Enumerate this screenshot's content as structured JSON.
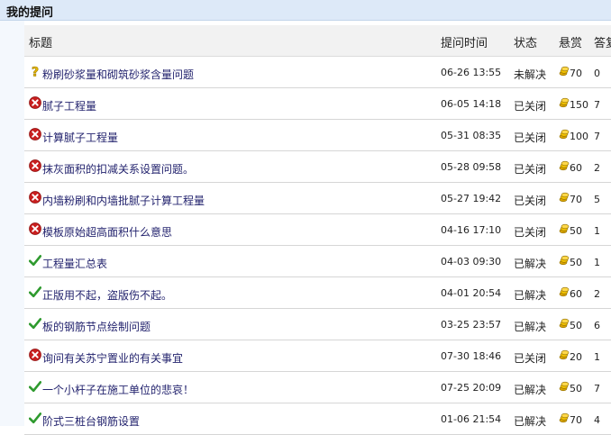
{
  "section": {
    "title": "我的提问"
  },
  "columns": {
    "title": "标题",
    "time": "提问时间",
    "status": "状态",
    "reward": "悬赏",
    "answers": "答复"
  },
  "rows": [
    {
      "icon": "question-icon",
      "title": "粉刷砂浆量和砌筑砂浆含量问题",
      "time": "06-26 13:55",
      "status": "未解决",
      "reward": "70",
      "answers": "0"
    },
    {
      "icon": "closed-icon",
      "title": "腻子工程量",
      "time": "06-05 14:18",
      "status": "已关闭",
      "reward": "150",
      "answers": "7"
    },
    {
      "icon": "closed-icon",
      "title": "计算腻子工程量",
      "time": "05-31 08:35",
      "status": "已关闭",
      "reward": "100",
      "answers": "7"
    },
    {
      "icon": "closed-icon",
      "title": "抹灰面积的扣减关系设置问题。",
      "time": "05-28 09:58",
      "status": "已关闭",
      "reward": "60",
      "answers": "2"
    },
    {
      "icon": "closed-icon",
      "title": "内墙粉刷和内墙批腻子计算工程量",
      "time": "05-27 19:42",
      "status": "已关闭",
      "reward": "70",
      "answers": "5"
    },
    {
      "icon": "closed-icon",
      "title": "模板原始超高面积什么意思",
      "time": "04-16 17:10",
      "status": "已关闭",
      "reward": "50",
      "answers": "1"
    },
    {
      "icon": "solved-icon",
      "title": "工程量汇总表",
      "time": "04-03 09:30",
      "status": "已解决",
      "reward": "50",
      "answers": "1"
    },
    {
      "icon": "solved-icon",
      "title": "正版用不起，盗版伤不起。",
      "time": "04-01 20:54",
      "status": "已解决",
      "reward": "60",
      "answers": "2"
    },
    {
      "icon": "solved-icon",
      "title": "板的钢筋节点绘制问题",
      "time": "03-25 23:57",
      "status": "已解决",
      "reward": "50",
      "answers": "6"
    },
    {
      "icon": "closed-icon",
      "title": "询问有关苏宁置业的有关事宜",
      "time": "07-30 18:46",
      "status": "已关闭",
      "reward": "20",
      "answers": "1"
    },
    {
      "icon": "solved-icon",
      "title": "一个小杆子在施工单位的悲哀！",
      "time": "07-25 20:09",
      "status": "已解决",
      "reward": "50",
      "answers": "7"
    },
    {
      "icon": "solved-icon",
      "title": "阶式三桩台钢筋设置",
      "time": "01-06 21:54",
      "status": "已解决",
      "reward": "70",
      "answers": "4"
    }
  ]
}
